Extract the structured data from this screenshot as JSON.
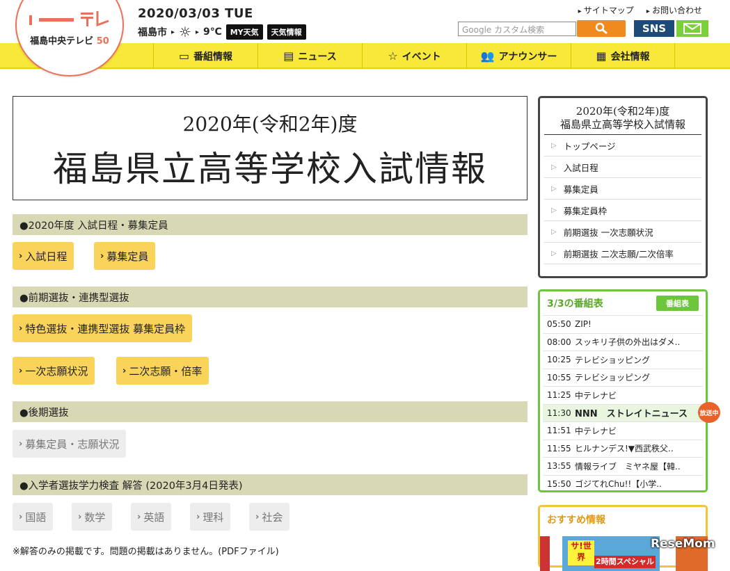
{
  "header": {
    "logo_text": "福島中央テレビ",
    "logo_anniv": "50",
    "date": "2020/03/03 TUE",
    "city": "福島市",
    "temp": "9℃",
    "my_weather": "MY天気",
    "weather_info": "天気情報",
    "links": [
      "サイトマップ",
      "お問い合わせ"
    ],
    "search_placeholder": "Google カスタム検索",
    "sns": "SNS"
  },
  "nav": [
    "番組情報",
    "ニュース",
    "イベント",
    "アナウンサー",
    "会社情報"
  ],
  "page_title": {
    "year": "2020年(令和2年)度",
    "main": "福島県立高等学校入試情報"
  },
  "sections": [
    {
      "title": "●2020年度 入試日程・募集定員",
      "buttons": [
        "入試日程",
        "募集定員"
      ]
    },
    {
      "title": "●前期選抜・連携型選抜",
      "buttons": [
        "特色選抜・連携型選抜 募集定員枠",
        "一次志願状況",
        "二次志願・倍率"
      ]
    },
    {
      "title": "●後期選抜",
      "buttons": [
        "募集定員・志願状況"
      ]
    },
    {
      "title": "●入学者選抜学力検査 解答 (2020年3月4日発表)",
      "buttons": [
        "国語",
        "数学",
        "英語",
        "理科",
        "社会"
      ]
    }
  ],
  "note": "※解答のみの掲載です。問題の掲載はありません。(PDFファイル)",
  "sidebar": {
    "title_line1": "2020年(令和2年)度",
    "title_line2": "福島県立高等学校入試情報",
    "links": [
      "トップページ",
      "入試日程",
      "募集定員",
      "募集定員枠",
      "前期選抜 一次志願状況",
      "前期選抜 二次志願/二次倍率"
    ]
  },
  "schedule": {
    "title": "3/3の番組表",
    "button": "番組表",
    "live_badge": "放送中",
    "rows": [
      {
        "time": "05:50",
        "title": "ZIP!"
      },
      {
        "time": "08:00",
        "title": "スッキリ子供の外出はダメ.."
      },
      {
        "time": "10:25",
        "title": "テレビショッピング"
      },
      {
        "time": "10:55",
        "title": "テレビショッピング"
      },
      {
        "time": "11:25",
        "title": "中テレナビ"
      },
      {
        "time": "11:30",
        "title": "NNN　ストレイトニュース"
      },
      {
        "time": "11:51",
        "title": "中テレナビ"
      },
      {
        "time": "11:55",
        "title": "ヒルナンデス!▼西武秩父.."
      },
      {
        "time": "13:55",
        "title": "情報ライブ　ミヤネ屋【韓.."
      },
      {
        "time": "15:50",
        "title": "ゴジてれChu!!【小学.."
      }
    ]
  },
  "reco": {
    "title": "おすすめ情報",
    "banner_badge": "サ!世界",
    "banner_text": "2時間スペシャル"
  },
  "watermark": "ReseMom"
}
